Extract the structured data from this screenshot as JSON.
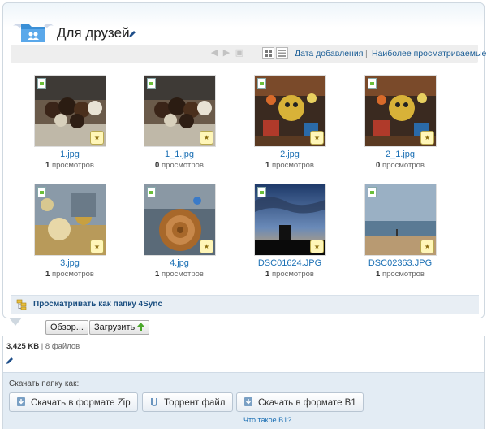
{
  "header": {
    "title": "Для друзей"
  },
  "toolbar": {
    "sort_by_date": "Дата добавления",
    "separator": "|",
    "sort_by_views": "Наиболее просматриваемые"
  },
  "files": [
    {
      "name": "1.jpg",
      "views_count": "1",
      "views_label": "просмотров"
    },
    {
      "name": "1_1.jpg",
      "views_count": "0",
      "views_label": "просмотров"
    },
    {
      "name": "2.jpg",
      "views_count": "1",
      "views_label": "просмотров"
    },
    {
      "name": "2_1.jpg",
      "views_count": "0",
      "views_label": "просмотров"
    },
    {
      "name": "3.jpg",
      "views_count": "1",
      "views_label": "просмотров"
    },
    {
      "name": "4.jpg",
      "views_count": "1",
      "views_label": "просмотров"
    },
    {
      "name": "DSC01624.JPG",
      "views_count": "1",
      "views_label": "просмотров"
    },
    {
      "name": "DSC02363.JPG",
      "views_count": "1",
      "views_label": "просмотров"
    }
  ],
  "folder_view_link": "Просматривать как папку 4Sync",
  "upload": {
    "browse_label": "Обзор...",
    "upload_label": "Загрузить"
  },
  "folder_info": {
    "size": "3,425 KB",
    "separator": "|",
    "file_count": "8 файлов"
  },
  "download": {
    "label": "Скачать папку как:",
    "zip_label": "Скачать в формате Zip",
    "torrent_label": "Торрент файл",
    "b1_label": "Скачать в формате B1",
    "b1_help": "Что такое B1?"
  },
  "colors": {
    "link": "#1a6fb4",
    "accent_green": "#6bbf3a",
    "toolbar_bg": "#eeeeee",
    "panel_border": "#cfd8e0"
  }
}
